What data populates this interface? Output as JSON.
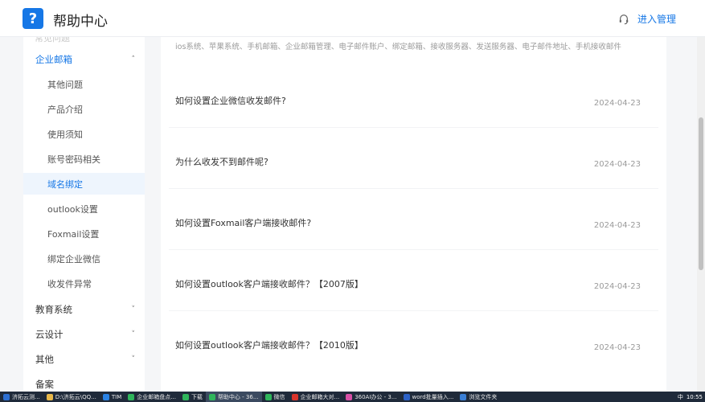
{
  "header": {
    "logo_glyph": "?",
    "title": "帮助中心",
    "admin_link": "进入管理"
  },
  "sidebar": {
    "cut_item": "常见问题",
    "items": [
      {
        "label": "企业邮箱",
        "level": "top",
        "chevron": "˄",
        "state": "open"
      },
      {
        "label": "其他问题",
        "level": "sub"
      },
      {
        "label": "产品介绍",
        "level": "sub"
      },
      {
        "label": "使用须知",
        "level": "sub"
      },
      {
        "label": "账号密码相关",
        "level": "sub"
      },
      {
        "label": "域名绑定",
        "level": "sub",
        "state": "active"
      },
      {
        "label": "outlook设置",
        "level": "sub"
      },
      {
        "label": "Foxmail设置",
        "level": "sub"
      },
      {
        "label": "绑定企业微信",
        "level": "sub"
      },
      {
        "label": "收发件异常",
        "level": "sub"
      },
      {
        "label": "教育系统",
        "level": "top",
        "chevron": "˅"
      },
      {
        "label": "云设计",
        "level": "top",
        "chevron": "˅"
      },
      {
        "label": "其他",
        "level": "top",
        "chevron": "˅"
      },
      {
        "label": "备案",
        "level": "top"
      }
    ]
  },
  "main": {
    "tags": "ios系统、苹果系统、手机邮箱、企业邮箱管理、电子邮件账户、绑定邮箱、接收服务器、发送服务器、电子邮件地址、手机接收邮件",
    "articles": [
      {
        "title": "如何设置企业微信收发邮件?",
        "date": "2024-04-23"
      },
      {
        "title": "为什么收发不到邮件呢?",
        "date": "2024-04-23"
      },
      {
        "title": "如何设置Foxmail客户端接收邮件?",
        "date": "2024-04-23"
      },
      {
        "title": "如何设置outlook客户端接收邮件？【2007版】",
        "date": "2024-04-23"
      },
      {
        "title": "如何设置outlook客户端接收邮件？【2010版】",
        "date": "2024-04-23"
      }
    ]
  },
  "taskbar": {
    "items": [
      {
        "label": "济拓云测...",
        "color": "#2d6fd1"
      },
      {
        "label": "D:\\济拓云\\QQ...",
        "color": "#e8b84a"
      },
      {
        "label": "TIM",
        "color": "#2a82e4"
      },
      {
        "label": "企业邮箱盘点...",
        "color": "#2fb55b"
      },
      {
        "label": "下载",
        "color": "#2fb55b"
      },
      {
        "label": "帮助中心 - 36...",
        "color": "#2fb55b",
        "active": true
      },
      {
        "label": "微信",
        "color": "#2fb55b"
      },
      {
        "label": "企业邮箱大对...",
        "color": "#d9342b"
      },
      {
        "label": "360AI办公 - 3...",
        "color": "#d84fa6"
      },
      {
        "label": "word批量插入...",
        "color": "#2b61c7"
      },
      {
        "label": "浏览文件夹",
        "color": "#3a7fd6"
      }
    ],
    "tray": "中",
    "time": "10:55"
  },
  "colors": {
    "accent": "#1677e6",
    "active_bg": "#eef5fd"
  }
}
